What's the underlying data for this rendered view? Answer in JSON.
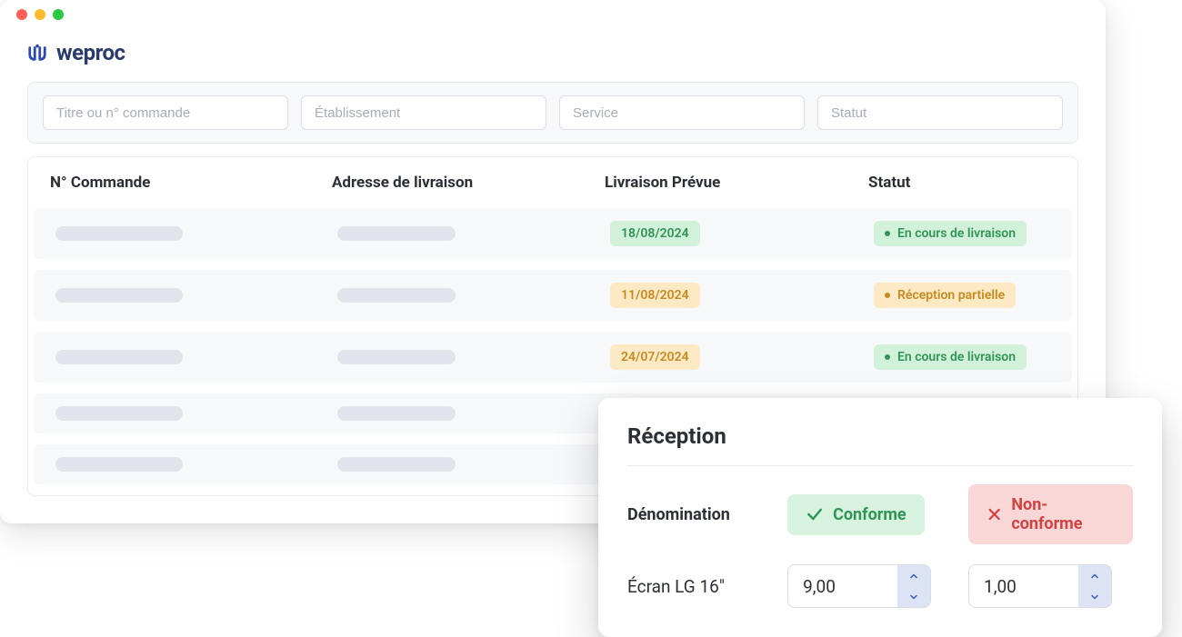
{
  "brand": {
    "name": "weproc"
  },
  "filters": {
    "search_placeholder": "Titre ou n° commande",
    "establishment_placeholder": "Établissement",
    "service_placeholder": "Service",
    "status_placeholder": "Statut"
  },
  "table": {
    "headers": {
      "order_no": "N° Commande",
      "address": "Adresse de livraison",
      "expected": "Livraison Prévue",
      "status": "Statut"
    },
    "rows": [
      {
        "date": "18/08/2024",
        "date_tone": "green",
        "status": "En cours de livraison",
        "status_tone": "green"
      },
      {
        "date": "11/08/2024",
        "date_tone": "amber",
        "status": "Réception partielle",
        "status_tone": "amber"
      },
      {
        "date": "24/07/2024",
        "date_tone": "amber",
        "status": "En cours de livraison",
        "status_tone": "green"
      },
      {
        "date": "",
        "date_tone": "",
        "status": "",
        "status_tone": ""
      },
      {
        "date": "",
        "date_tone": "",
        "status": "",
        "status_tone": ""
      }
    ]
  },
  "panel": {
    "title": "Réception",
    "denomination_label": "Dénomination",
    "conforme_label": "Conforme",
    "nonconforme_label": "Non-conforme",
    "product": "Écran LG 16\"",
    "qty_conforme": "9,00",
    "qty_nonconforme": "1,00"
  }
}
